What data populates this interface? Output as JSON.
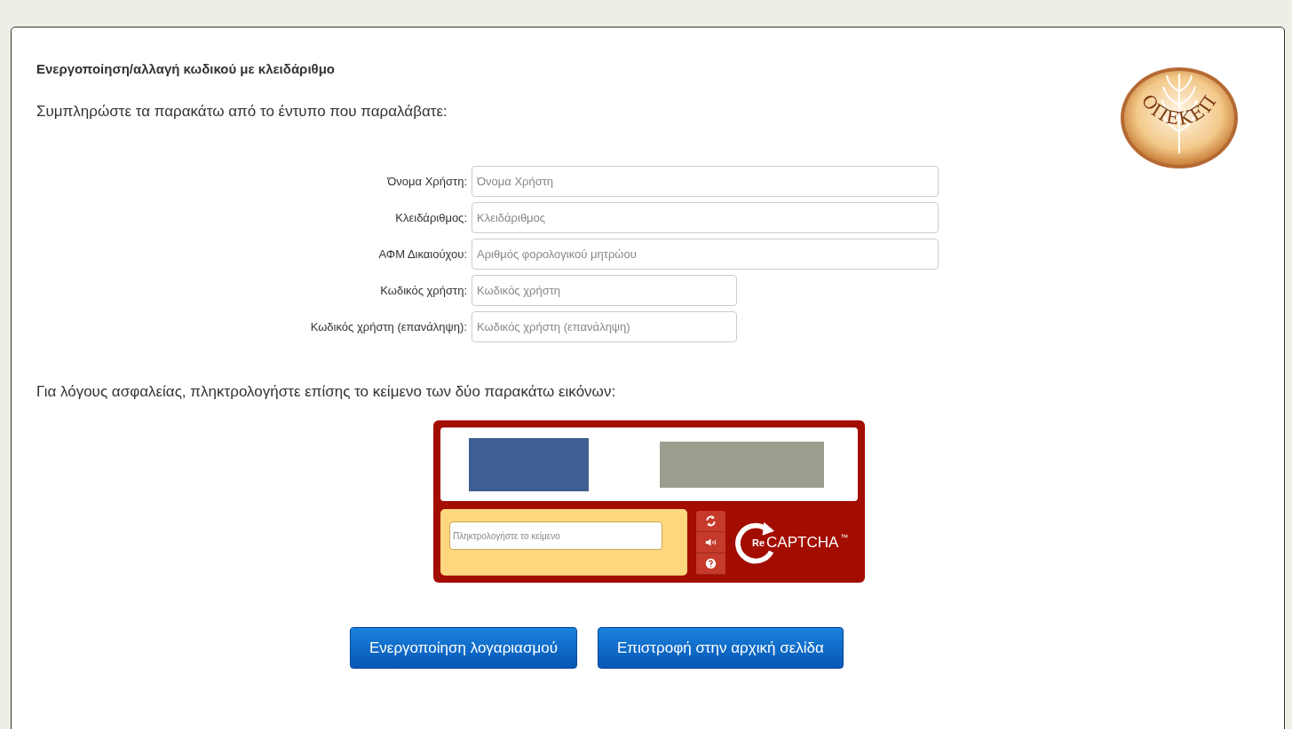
{
  "title": "Ενεργοποίηση/αλλαγή κωδικού με κλειδάριθμο",
  "intro": "Συμπληρώστε τα παρακάτω από το έντυπο που παραλάβατε:",
  "logo": {
    "text": "ΟΠΕΚΕΠ"
  },
  "fields": [
    {
      "label": "Όνομα Χρήστη:",
      "placeholder": "Όνομα Χρήστη",
      "kind": "long"
    },
    {
      "label": "Κλειδάριθμος:",
      "placeholder": "Κλειδάριθμος",
      "kind": "long"
    },
    {
      "label": "ΑΦΜ Δικαιούχου:",
      "placeholder": "Αριθμός φορολογικού μητρώου",
      "kind": "long"
    },
    {
      "label": "Κωδικός χρήστη:",
      "placeholder": "Κωδικός χρήστη",
      "kind": "short"
    },
    {
      "label": "Κωδικός χρήστη (επανάληψη):",
      "placeholder": "Κωδικός χρήστη (επανάληψη)",
      "kind": "short"
    }
  ],
  "captcha_prompt": "Για λόγους ασφαλείας, πληκτρολογήστε επίσης το κείμενο των δύο παρακάτω εικόνων:",
  "captcha": {
    "placeholder": "Πληκτρολογήστε το κείμενο",
    "brand_prefix": "Re",
    "brand": "CAPTCHA",
    "brand_mark": "™"
  },
  "buttons": [
    "Ενεργοποίηση λογαριασμού",
    "Επιστροφή στην αρχική σελίδα"
  ]
}
